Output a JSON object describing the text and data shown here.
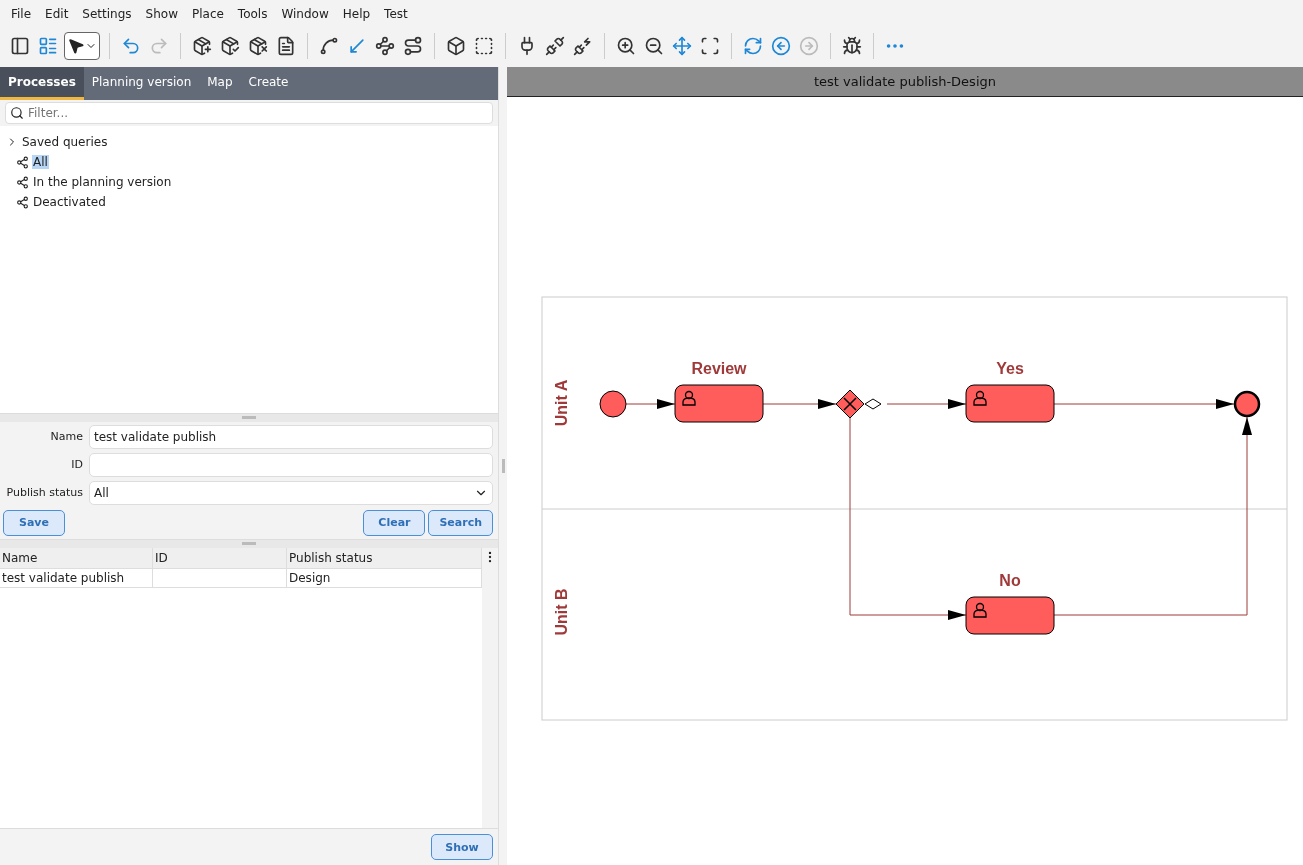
{
  "menu": [
    "File",
    "Edit",
    "Settings",
    "Show",
    "Place",
    "Tools",
    "Window",
    "Help",
    "Test"
  ],
  "tabs": [
    {
      "label": "Processes",
      "selected": true
    },
    {
      "label": "Planning version",
      "selected": false
    },
    {
      "label": "Map",
      "selected": false
    },
    {
      "label": "Create",
      "selected": false
    }
  ],
  "filter": {
    "placeholder": "Filter..."
  },
  "tree": [
    {
      "label": "Saved queries",
      "expanded": false,
      "kind": "folder",
      "selected": false
    },
    {
      "label": "All",
      "kind": "query",
      "selected": true
    },
    {
      "label": "In the planning version",
      "kind": "query",
      "selected": false
    },
    {
      "label": "Deactivated",
      "kind": "query",
      "selected": false
    }
  ],
  "form": {
    "fields": [
      {
        "label": "Name",
        "value": "test validate publish",
        "kind": "text"
      },
      {
        "label": "ID",
        "kind": "text"
      },
      {
        "label": "Publish status",
        "value": "All",
        "kind": "select"
      }
    ],
    "buttons_left": [
      "Save"
    ],
    "buttons_right": [
      "Clear",
      "Search"
    ]
  },
  "table": {
    "columns": [
      "Name",
      "ID",
      "Publish status"
    ],
    "rows": [
      [
        "test validate publish",
        "",
        "Design"
      ]
    ]
  },
  "footer_button": "Show",
  "diagram": {
    "title": "test validate publish-Design",
    "lanes": [
      "Unit A",
      "Unit B"
    ],
    "tasks": [
      "Review",
      "Yes",
      "No"
    ]
  }
}
